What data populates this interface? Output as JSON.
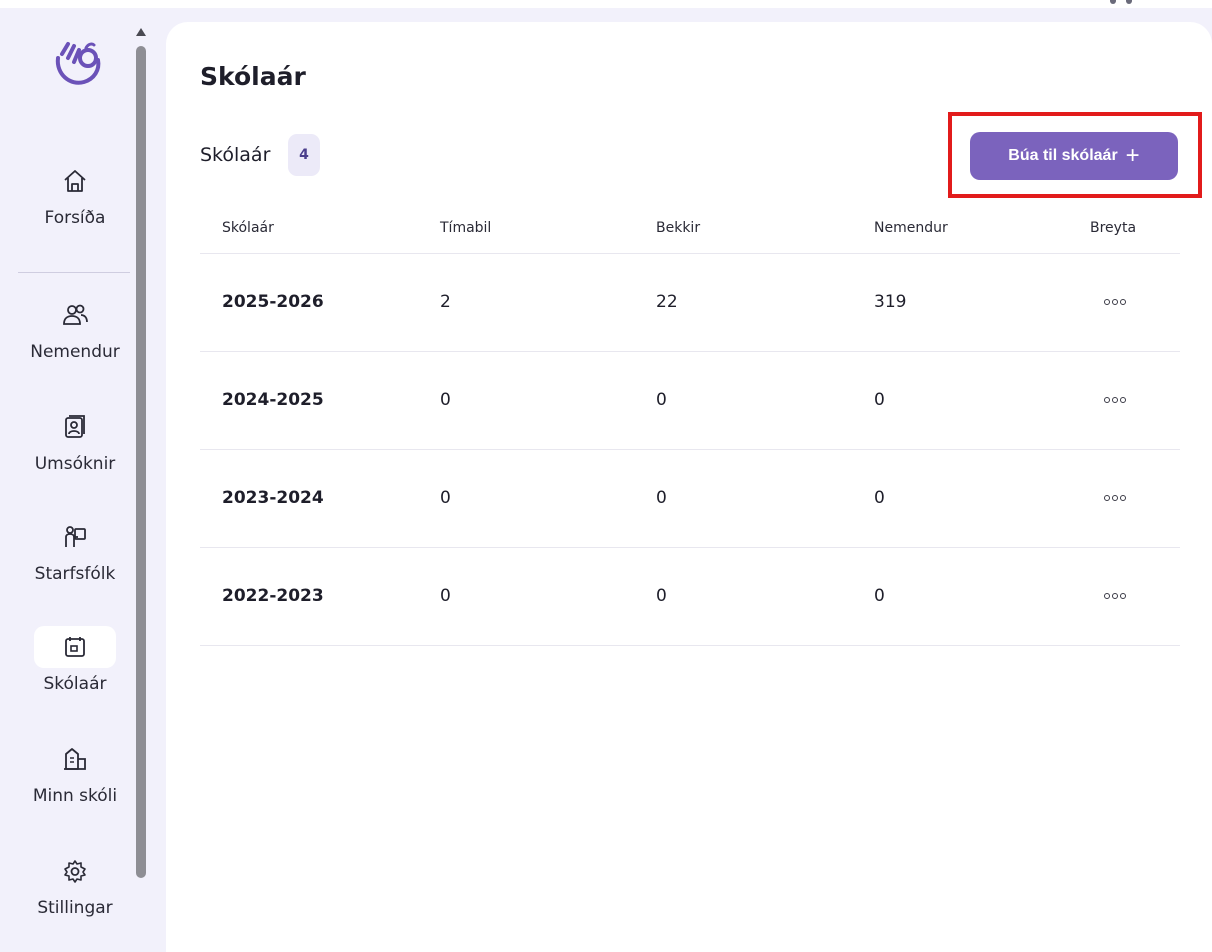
{
  "sidebar": {
    "items": [
      {
        "id": "home",
        "label": "Forsíða",
        "icon": "home-icon"
      },
      {
        "id": "students",
        "label": "Nemendur",
        "icon": "users-icon"
      },
      {
        "id": "applications",
        "label": "Umsóknir",
        "icon": "id-card-icon"
      },
      {
        "id": "staff",
        "label": "Starfsfólk",
        "icon": "staff-icon"
      },
      {
        "id": "school-years",
        "label": "Skólaár",
        "icon": "calendar-icon",
        "active": true
      },
      {
        "id": "my-school",
        "label": "Minn skóli",
        "icon": "building-icon"
      },
      {
        "id": "settings",
        "label": "Stillingar",
        "icon": "gear-icon"
      }
    ]
  },
  "main": {
    "page_title": "Skólaár",
    "section_title": "Skólaár",
    "count": "4",
    "create_button": "Búa til skólaár",
    "table": {
      "headers": [
        "Skólaár",
        "Tímabil",
        "Bekkir",
        "Nemendur",
        "Breyta"
      ],
      "rows": [
        {
          "year": "2025-2026",
          "periods": "2",
          "classes": "22",
          "students": "319"
        },
        {
          "year": "2024-2025",
          "periods": "0",
          "classes": "0",
          "students": "0"
        },
        {
          "year": "2023-2024",
          "periods": "0",
          "classes": "0",
          "students": "0"
        },
        {
          "year": "2022-2023",
          "periods": "0",
          "classes": "0",
          "students": "0"
        }
      ]
    }
  },
  "colors": {
    "accent": "#7b63bd",
    "highlight": "#e21b1b",
    "sidebar_bg": "#f2f1fb"
  }
}
